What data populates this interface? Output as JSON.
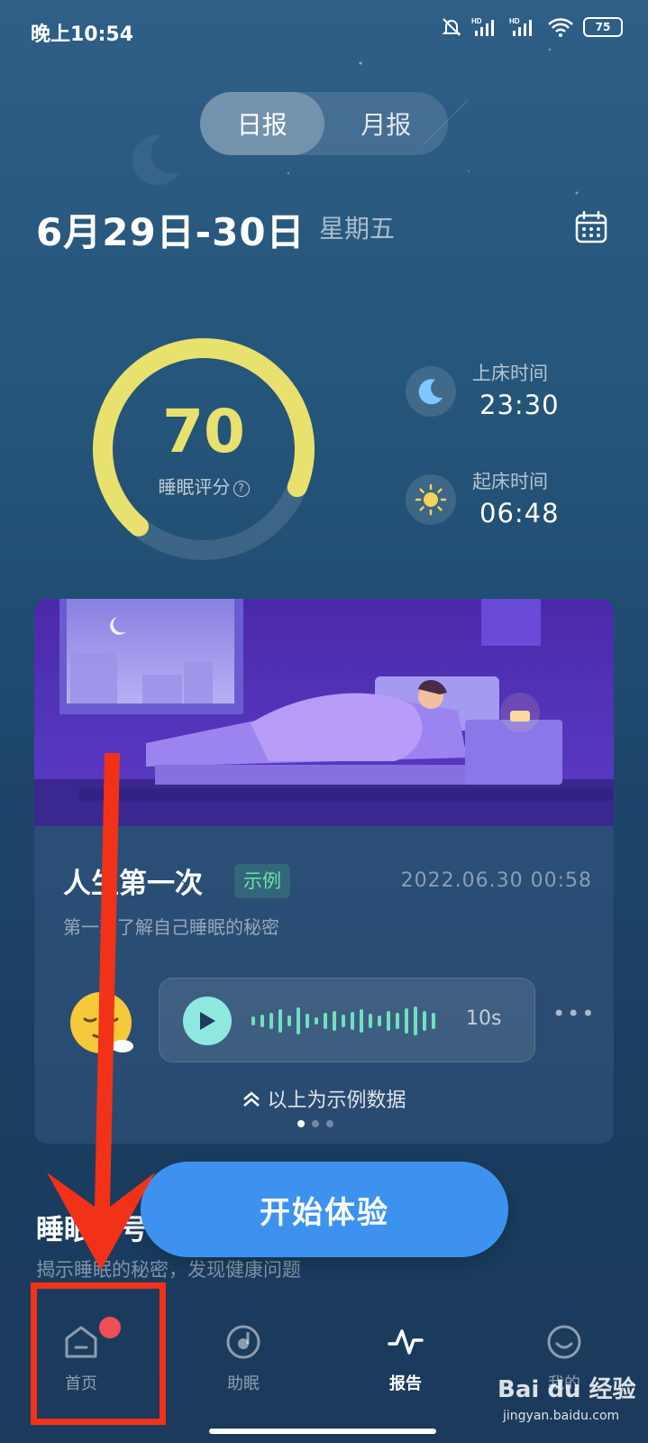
{
  "status_bar": {
    "time": "晚上10:54",
    "battery": "75",
    "icons": [
      "mute-bell-icon",
      "hd-signal-icon",
      "hd-signal-icon",
      "wifi-icon",
      "battery-icon"
    ]
  },
  "tabs": [
    {
      "label": "日报",
      "active": true
    },
    {
      "label": "月报",
      "active": false
    }
  ],
  "date_header": {
    "date_range": "6月29日-30日",
    "weekday": "星期五",
    "calendar_icon": "calendar-icon"
  },
  "score": {
    "value": "70",
    "label": "睡眠评分",
    "ring_fraction": 0.7,
    "ring_color": "#e8e16d"
  },
  "bed_time": {
    "label": "上床时间",
    "value": "23:30",
    "icon": "moon-icon"
  },
  "wake_time": {
    "label": "起床时间",
    "value": "06:48",
    "icon": "sun-icon"
  },
  "card": {
    "title": "人生第一次",
    "badge": "示例",
    "datetime": "2022.06.30 00:58",
    "description": "第一次了解自己睡眠的秘密",
    "voice": {
      "duration": "10s"
    },
    "example_note": "以上为示例数据",
    "pager_count": 3,
    "pager_active": 0
  },
  "start_button": {
    "label": "开始体验"
  },
  "section": {
    "title": "睡眠音号",
    "subtitle": "揭示睡眠的秘密，发现健康问题"
  },
  "bottom_nav": [
    {
      "label": "首页",
      "icon": "home-icon",
      "active": false,
      "badge": true
    },
    {
      "label": "助眠",
      "icon": "sleep-aid-icon",
      "active": false,
      "badge": false
    },
    {
      "label": "报告",
      "icon": "report-pulse-icon",
      "active": true,
      "badge": false
    },
    {
      "label": "我的",
      "icon": "profile-face-icon",
      "active": false,
      "badge": false
    }
  ],
  "watermark": {
    "logo": "Bai du 经验",
    "url": "jingyan.baidu.com"
  },
  "colors": {
    "accent_blue": "#3d92f0",
    "score_yellow": "#e8e16d",
    "badge_green": "#6fe0a8",
    "annotation_red": "#f23218"
  }
}
